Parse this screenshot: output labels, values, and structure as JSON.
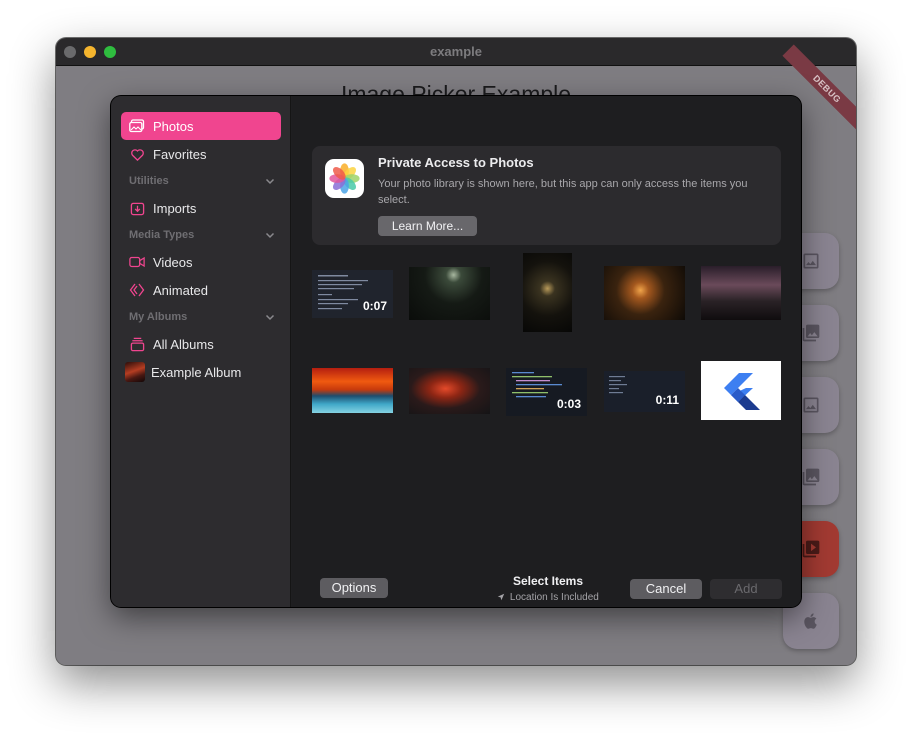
{
  "window": {
    "title": "example"
  },
  "app": {
    "heading": "Image Picker Example",
    "debug_banner": "DEBUG"
  },
  "fabs": [
    {
      "icon": "image-icon"
    },
    {
      "icon": "image-icon"
    },
    {
      "icon": "image-icon"
    },
    {
      "icon": "image-icon"
    },
    {
      "icon": "video-icon",
      "color": "#a23a32"
    },
    {
      "icon": "apple-icon"
    }
  ],
  "sidebar": {
    "items": [
      {
        "label": "Photos",
        "icon": "photos-icon",
        "active": true
      },
      {
        "label": "Favorites",
        "icon": "heart-icon"
      },
      {
        "label": "Imports",
        "icon": "import-icon"
      },
      {
        "label": "Videos",
        "icon": "video-icon"
      },
      {
        "label": "Animated",
        "icon": "animated-icon"
      },
      {
        "label": "All Albums",
        "icon": "albums-icon"
      },
      {
        "label": "Example Album",
        "icon": "album-thumbnail"
      }
    ],
    "sections": {
      "utilities": "Utilities",
      "media_types": "Media Types",
      "my_albums": "My Albums"
    }
  },
  "notice": {
    "title": "Private Access to Photos",
    "body": "Your photo library is shown here, but this app can only access the items you select.",
    "button": "Learn More..."
  },
  "grid": {
    "durations": [
      "0:07",
      "0:03",
      "0:11"
    ]
  },
  "footer": {
    "options": "Options",
    "title": "Select Items",
    "subtitle": "Location Is Included",
    "cancel": "Cancel",
    "add": "Add"
  },
  "colors": {
    "accent": "#f0458f",
    "picker_bg": "#1e1e20",
    "sidebar_bg": "#2d2c2f"
  }
}
